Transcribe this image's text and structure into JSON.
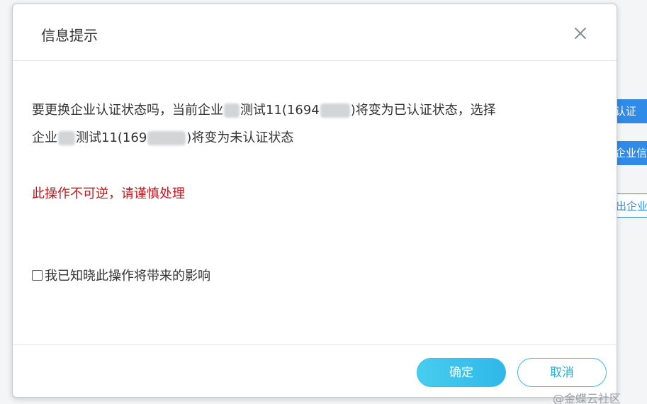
{
  "dialog": {
    "title": "信息提示",
    "message": {
      "line1_prefix": "要更换企业认证状态吗，当前企业",
      "line1_mid": "测试11(1694",
      "line1_suffix": ")将变为已认证状态，选择",
      "line2_prefix": "企业",
      "line2_mid": "测试11(169",
      "line2_suffix": ")将变为未认证状态"
    },
    "warning": "此操作不可逆，请谨慎处理",
    "acknowledge": {
      "label": "我已知晓此操作将带来的影响",
      "checked": false
    },
    "confirm_label": "确定",
    "cancel_label": "取消"
  },
  "background": {
    "buttons": [
      "认证",
      "企业信",
      "出企业"
    ]
  },
  "watermark": "@金蝶云社区",
  "colors": {
    "warning": "#c2171c",
    "primary": "#2eb8e8",
    "background_button": "#2f8ae8"
  },
  "icons": {
    "close": "close-icon"
  }
}
